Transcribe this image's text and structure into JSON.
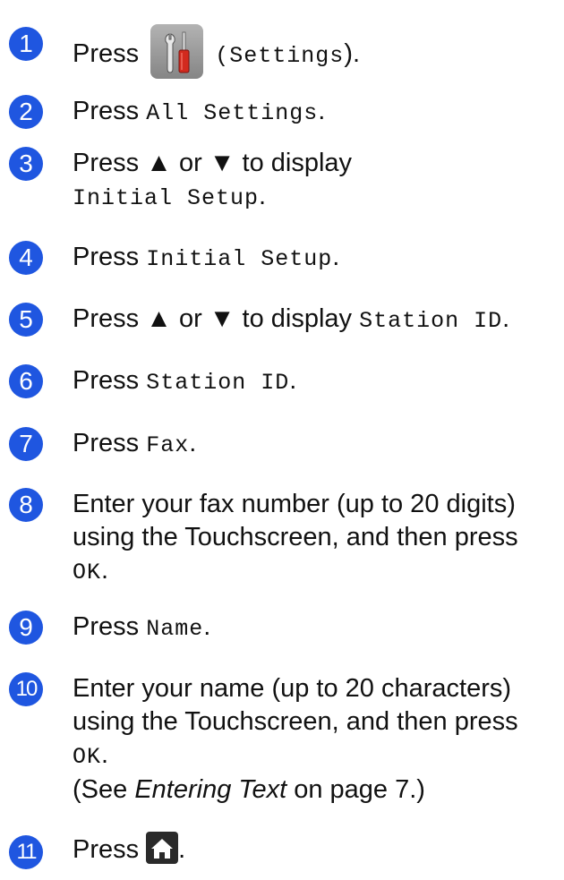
{
  "steps": [
    {
      "n": "1",
      "press": "Press",
      "open": "(",
      "mono": "Settings",
      "close": ").",
      "icon": "settings-icon"
    },
    {
      "n": "2",
      "press": "Press",
      "mono": "All Settings",
      "end": "."
    },
    {
      "n": "3",
      "line1": "Press ▲ or ▼ to display",
      "mono": "Initial Setup",
      "end": "."
    },
    {
      "n": "4",
      "press": "Press",
      "mono": "Initial Setup",
      "end": "."
    },
    {
      "n": "5",
      "text": "Press ▲ or ▼ to display",
      "mono": "Station ID",
      "end": "."
    },
    {
      "n": "6",
      "press": "Press",
      "mono": "Station ID",
      "end": "."
    },
    {
      "n": "7",
      "press": "Press",
      "mono": "Fax",
      "end": "."
    },
    {
      "n": "8",
      "line1": "Enter your fax number (up to 20 digits)",
      "line2": "using the Touchscreen, and then press",
      "mono": "OK",
      "end": "."
    },
    {
      "n": "9",
      "press": "Press",
      "mono": "Name",
      "end": "."
    },
    {
      "n": "10",
      "line1": "Enter your name (up to 20 characters)",
      "line2": "using the Touchscreen, and then press",
      "mono": "OK",
      "end": ".",
      "see_open": "(See",
      "see_link": "Entering Text",
      "see_rest": "on page 7.)"
    },
    {
      "n": "11",
      "press": "Press",
      "end": ".",
      "icon": "home-icon"
    }
  ],
  "colors": {
    "step_badge": "#1f56e0",
    "icon_bg": "#9a9a9a",
    "home_icon": "#2a2a2a"
  }
}
